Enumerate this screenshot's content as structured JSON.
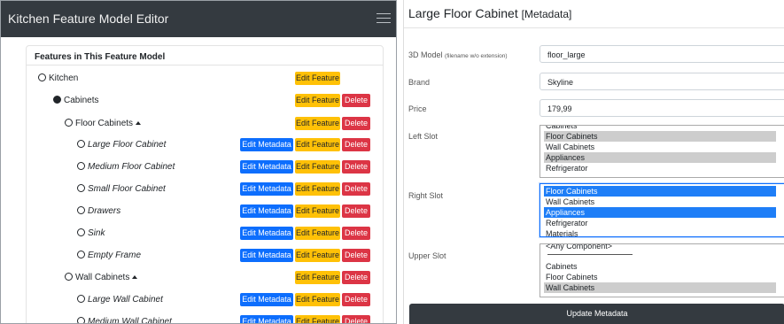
{
  "navbar": {
    "title": "Kitchen Feature Model Editor"
  },
  "tree": {
    "header": "Features in This Feature Model",
    "buttons": {
      "edit_metadata": "Edit Metadata",
      "edit_feature": "Edit Feature",
      "delete": "Delete"
    },
    "rows": [
      {
        "label": "Kitchen",
        "italic": false,
        "filled": false,
        "caret": false,
        "meta": false,
        "del": false
      },
      {
        "label": "Cabinets",
        "italic": false,
        "filled": true,
        "caret": false,
        "meta": false,
        "del": true
      },
      {
        "label": "Floor Cabinets",
        "italic": false,
        "filled": false,
        "caret": true,
        "meta": false,
        "del": true
      },
      {
        "label": "Large Floor Cabinet",
        "italic": true,
        "filled": false,
        "caret": false,
        "meta": true,
        "del": true
      },
      {
        "label": "Medium Floor Cabinet",
        "italic": true,
        "filled": false,
        "caret": false,
        "meta": true,
        "del": true
      },
      {
        "label": "Small Floor Cabinet",
        "italic": true,
        "filled": false,
        "caret": false,
        "meta": true,
        "del": true
      },
      {
        "label": "Drawers",
        "italic": true,
        "filled": false,
        "caret": false,
        "meta": true,
        "del": true
      },
      {
        "label": "Sink",
        "italic": true,
        "filled": false,
        "caret": false,
        "meta": true,
        "del": true
      },
      {
        "label": "Empty Frame",
        "italic": true,
        "filled": false,
        "caret": false,
        "meta": true,
        "del": true
      },
      {
        "label": "Wall Cabinets",
        "italic": false,
        "filled": false,
        "caret": true,
        "meta": false,
        "del": true
      },
      {
        "label": "Large Wall Cabinet",
        "italic": true,
        "filled": false,
        "caret": false,
        "meta": true,
        "del": true
      },
      {
        "label": "Medium Wall Cabinet",
        "italic": true,
        "filled": false,
        "caret": false,
        "meta": true,
        "del": true
      }
    ]
  },
  "form": {
    "title": "Large Floor Cabinet",
    "title_suffix": "[Metadata]",
    "model_label": "3D Model",
    "model_hint": "(filename w/o extension)",
    "model_value": "floor_large",
    "brand_label": "Brand",
    "brand_value": "Skyline",
    "price_label": "Price",
    "price_value": "179,99",
    "left_slot_label": "Left Slot",
    "left_slot_options": [
      {
        "text": "Cabinets",
        "selected": false
      },
      {
        "text": "Floor Cabinets",
        "selected": true
      },
      {
        "text": "Wall Cabinets",
        "selected": false
      },
      {
        "text": "Appliances",
        "selected": true
      },
      {
        "text": "Refrigerator",
        "selected": false
      }
    ],
    "right_slot_label": "Right Slot",
    "right_slot_options": [
      {
        "text": "Floor Cabinets",
        "selected": true
      },
      {
        "text": "Wall Cabinets",
        "selected": false
      },
      {
        "text": "Appliances",
        "selected": true
      },
      {
        "text": "Refrigerator",
        "selected": false
      },
      {
        "text": "Materials",
        "selected": false
      }
    ],
    "upper_slot_label": "Upper Slot",
    "upper_slot_options": [
      {
        "text": "<Any Component>",
        "selected": false
      },
      {
        "text": "Cabinets",
        "selected": false
      },
      {
        "text": "Floor Cabinets",
        "selected": false
      },
      {
        "text": "Wall Cabinets",
        "selected": true
      }
    ],
    "update_button": "Update Metadata"
  }
}
